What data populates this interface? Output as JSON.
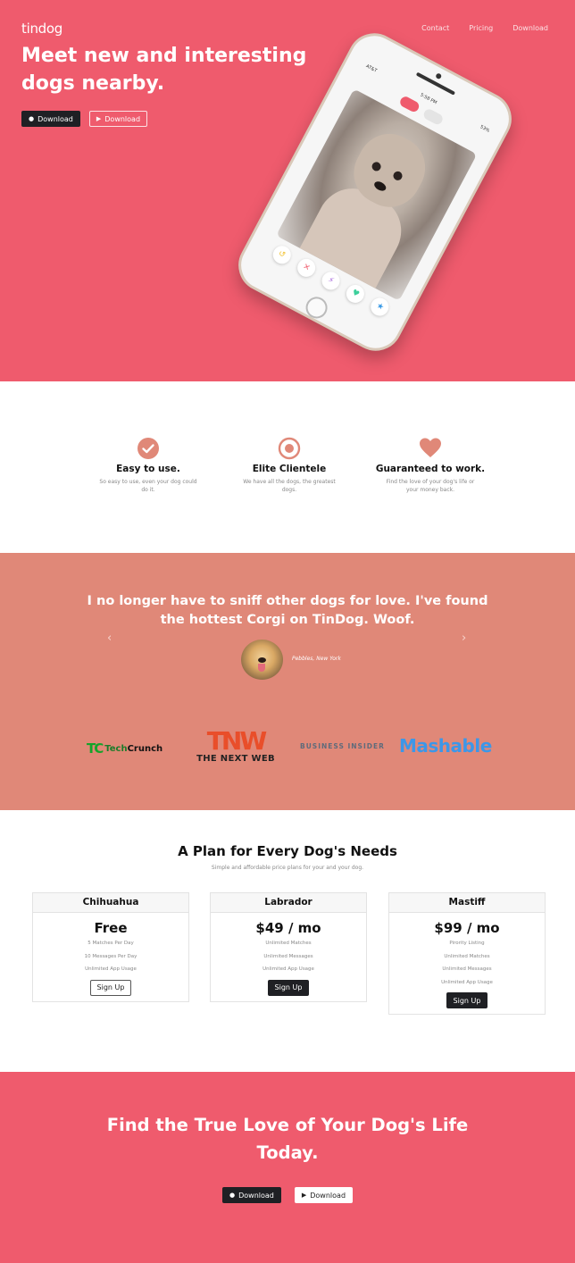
{
  "brand": "tindog",
  "nav": [
    "Contact",
    "Pricing",
    "Download"
  ],
  "hero": {
    "heading": "Meet new and interesting dogs nearby.",
    "buttons": [
      "Download",
      "Download"
    ]
  },
  "phone": {
    "carrier": "AT&T",
    "time": "5:58 PM",
    "battery": "53%"
  },
  "features": [
    {
      "icon": "check-circle-icon",
      "title": "Easy to use.",
      "text": "So easy to use, even your dog could do it."
    },
    {
      "icon": "bullseye-icon",
      "title": "Elite Clientele",
      "text": "We have all the dogs, the greatest dogs."
    },
    {
      "icon": "heart-icon",
      "title": "Guaranteed to work.",
      "text": "Find the love of your dog's life or your money back."
    }
  ],
  "testimonial": {
    "quote": "I no longer have to sniff other dogs for love. I've found the hottest Corgi on TinDog. Woof.",
    "author": "Pebbles, New York"
  },
  "press": {
    "techcrunch": {
      "mark": "TC",
      "text_a": "Tech",
      "text_b": "Crunch"
    },
    "tnw": {
      "mark": "TNW",
      "sub": "THE NEXT WEB"
    },
    "business_insider": "BUSINESS INSIDER",
    "mashable": "Mashable"
  },
  "pricing": {
    "title": "A Plan for Every Dog's Needs",
    "subtitle": "Simple and affordable price plans for your and your dog.",
    "plans": [
      {
        "name": "Chihuahua",
        "price": "Free",
        "features": [
          "5 Matches Per Day",
          "10 Messages Per Day",
          "Unlimited App Usage"
        ],
        "button": "Sign Up"
      },
      {
        "name": "Labrador",
        "price": "$49 / mo",
        "features": [
          "Unlimited Matches",
          "Unlimited Messages",
          "Unlimited App Usage"
        ],
        "button": "Sign Up"
      },
      {
        "name": "Mastiff",
        "price": "$99 / mo",
        "features": [
          "Pirority Listing",
          "Unlimited Matches",
          "Unlimited Messages",
          "Unlimited App Usage"
        ],
        "button": "Sign Up"
      }
    ]
  },
  "cta": {
    "heading": "Find the True Love of Your Dog's Life Today.",
    "buttons": [
      "Download",
      "Download"
    ]
  },
  "colors": {
    "primary": "#ef5b6d",
    "testimonial_bg": "#e08878",
    "dark": "#1f2024"
  }
}
